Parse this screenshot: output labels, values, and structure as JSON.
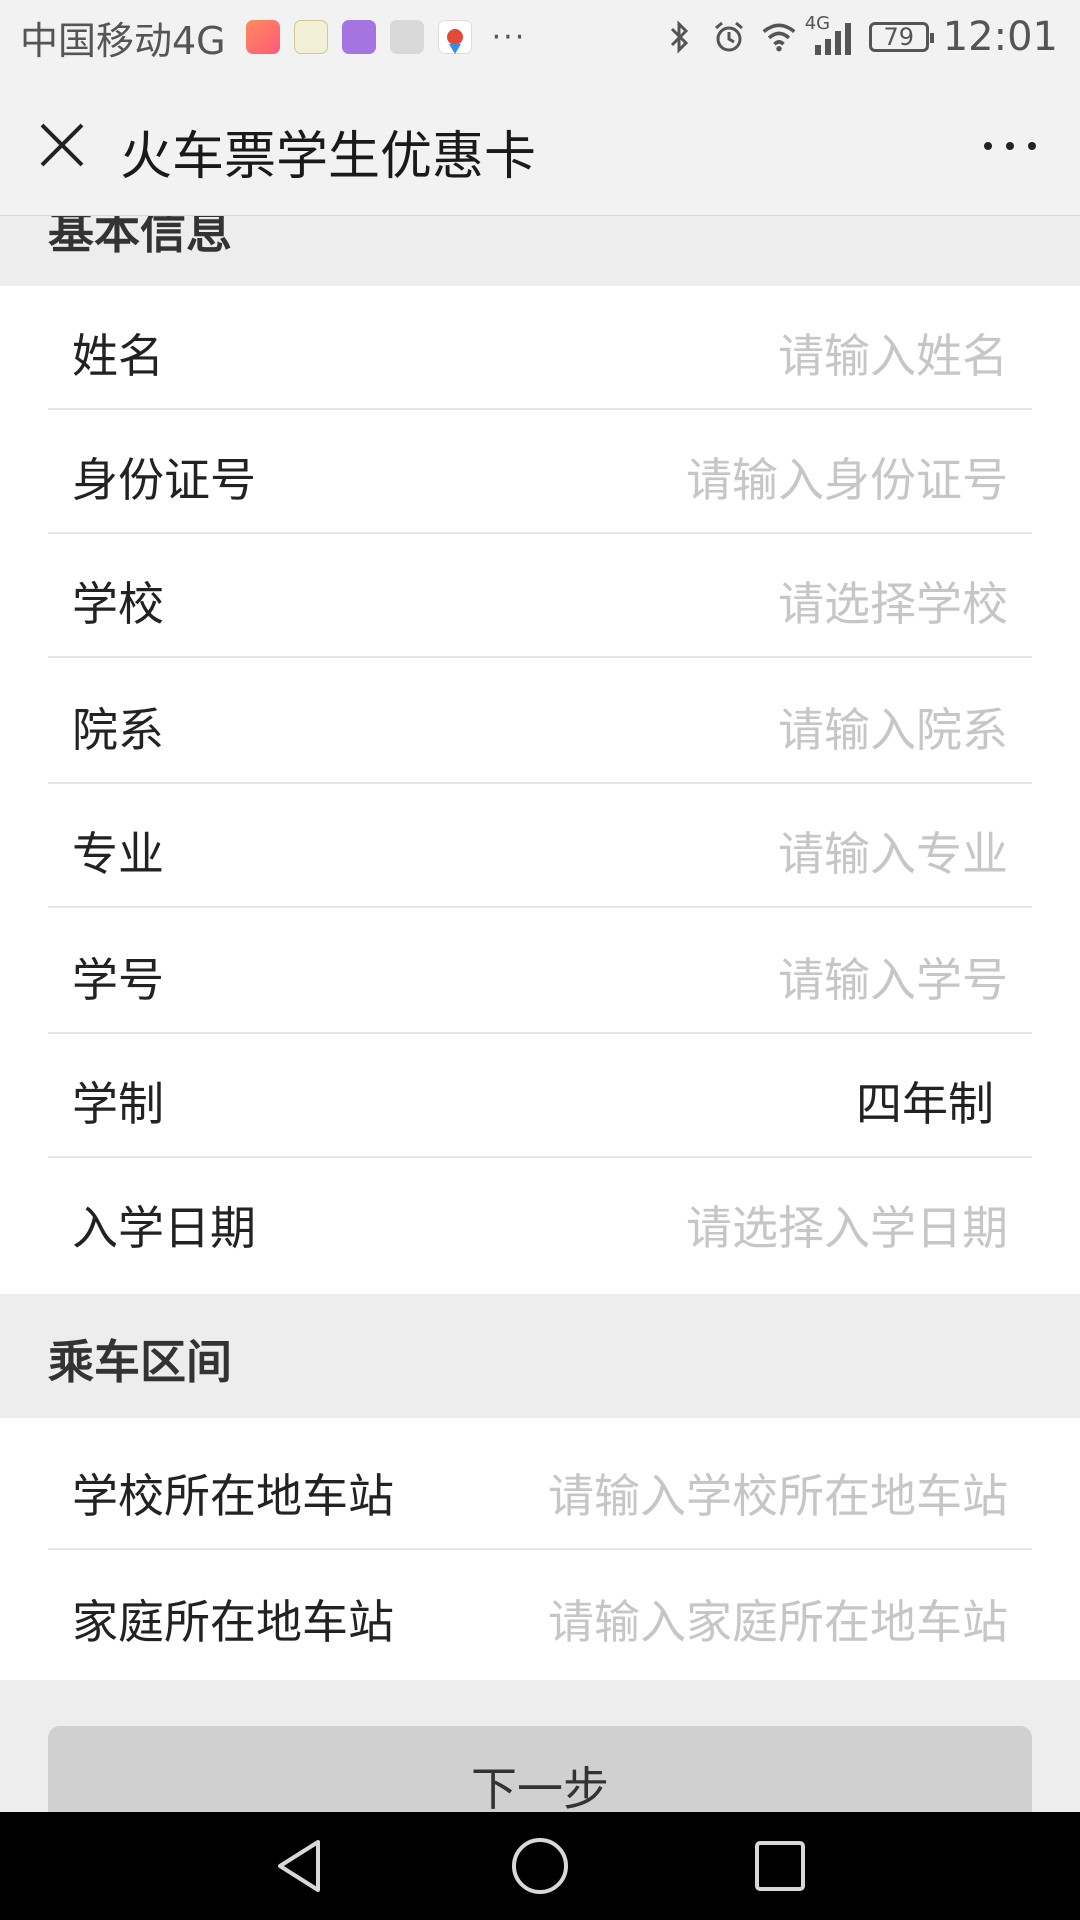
{
  "status_bar": {
    "carrier": "中国移动4G",
    "more": "···",
    "network_badge": "4G",
    "battery": "79",
    "time": "12:01",
    "icons": [
      "health-app-icon",
      "education-app-icon",
      "gallery-app-icon",
      "font-app-icon",
      "map-app-icon",
      "bluetooth-icon",
      "alarm-icon",
      "wifi-icon",
      "signal-icon",
      "battery-icon"
    ]
  },
  "header": {
    "title": "火车票学生优惠卡"
  },
  "sections": {
    "basic": {
      "title": "基本信息",
      "fields": [
        {
          "label": "姓名",
          "placeholder": "请输入姓名"
        },
        {
          "label": "身份证号",
          "placeholder": "请输入身份证号"
        },
        {
          "label": "学校",
          "placeholder": "请选择学校"
        },
        {
          "label": "院系",
          "placeholder": "请输入院系"
        },
        {
          "label": "专业",
          "placeholder": "请输入专业"
        },
        {
          "label": "学号",
          "placeholder": "请输入学号"
        },
        {
          "label": "学制",
          "value": "四年制"
        },
        {
          "label": "入学日期",
          "placeholder": "请选择入学日期"
        }
      ]
    },
    "route": {
      "title": "乘车区间",
      "fields": [
        {
          "label": "学校所在地车站",
          "placeholder": "请输入学校所在地车站"
        },
        {
          "label": "家庭所在地车站",
          "placeholder": "请输入家庭所在地车站"
        }
      ]
    }
  },
  "footer": {
    "next_label": "下一步"
  },
  "nav_bar": {
    "icons": [
      "back-icon",
      "home-icon",
      "recents-icon"
    ]
  }
}
